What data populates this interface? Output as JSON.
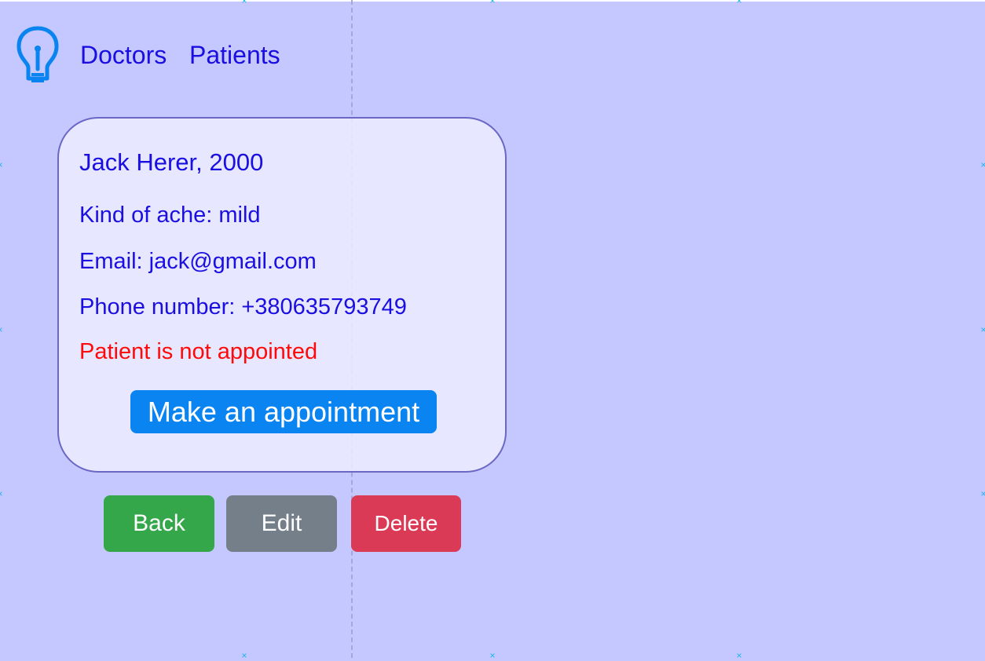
{
  "nav": {
    "logo_icon": "lightbulb-icon",
    "links": [
      {
        "label": "Doctors"
      },
      {
        "label": "Patients"
      }
    ]
  },
  "patient": {
    "name_year": "Jack Herer, 2000",
    "ache": "Kind of ache: mild",
    "email": "Email: jack@gmail.com",
    "phone": "Phone number: +380635793749",
    "status": "Patient is not appointed"
  },
  "appointment_button": {
    "label": "Make an appointment"
  },
  "actions": {
    "back_label": "Back",
    "edit_label": "Edit",
    "delete_label": "Delete"
  },
  "colors": {
    "background": "#c5c7ff",
    "text": "#1a0fe0",
    "status_red": "#ff0a0a",
    "primary": "#0a84f1",
    "success": "#35a74b",
    "secondary": "#757f8a",
    "danger": "#da3a56",
    "marker": "#19b5f0"
  }
}
